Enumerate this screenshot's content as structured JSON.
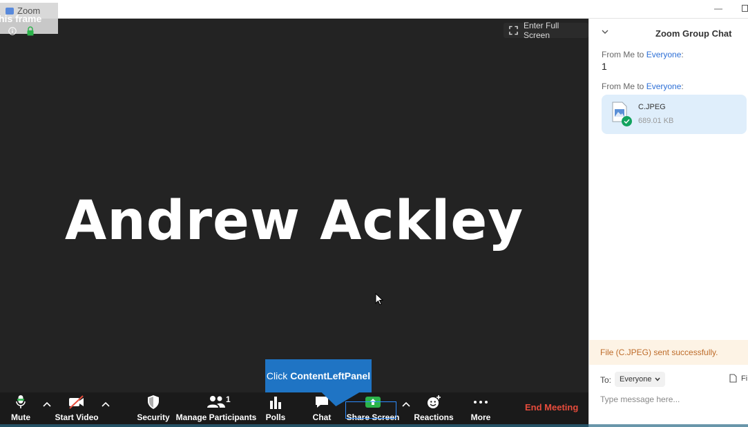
{
  "window": {
    "title": "Zoom",
    "frame_label": "his frame"
  },
  "video": {
    "fullscreen_label": "Enter Full Screen",
    "participant_name": "Andrew Ackley"
  },
  "toolbar": {
    "mute_label": "Mute",
    "start_video_label": "Start Video",
    "security_label": "Security",
    "manage_participants_label": "Manage Participants",
    "participant_count": "1",
    "polls_label": "Polls",
    "chat_label": "Chat",
    "share_screen_label": "Share Screen",
    "reactions_label": "Reactions",
    "more_label": "More",
    "end_meeting_label": "End Meeting"
  },
  "tooltip": {
    "prefix": "Click",
    "target": "ContentLeftPanel"
  },
  "chat": {
    "title": "Zoom Group Chat",
    "messages": [
      {
        "from": "From Me to ",
        "to": "Everyone",
        "suffix": ":",
        "text": "1"
      },
      {
        "from": "From Me to ",
        "to": "Everyone",
        "suffix": ":",
        "file_name": "C.JPEG",
        "file_size": "689.01 KB"
      }
    ],
    "notice": "File (C.JPEG) sent successfully.",
    "to_label": "To:",
    "recipient": "Everyone",
    "file_button_label": "Fi",
    "input_placeholder": "Type message here..."
  },
  "colors": {
    "end_meeting": "#e74c3c",
    "share_green": "#2bb34a",
    "link_blue": "#2d6fd6",
    "tooltip_blue": "#1f74c4",
    "notice_text": "#bd6b29"
  }
}
